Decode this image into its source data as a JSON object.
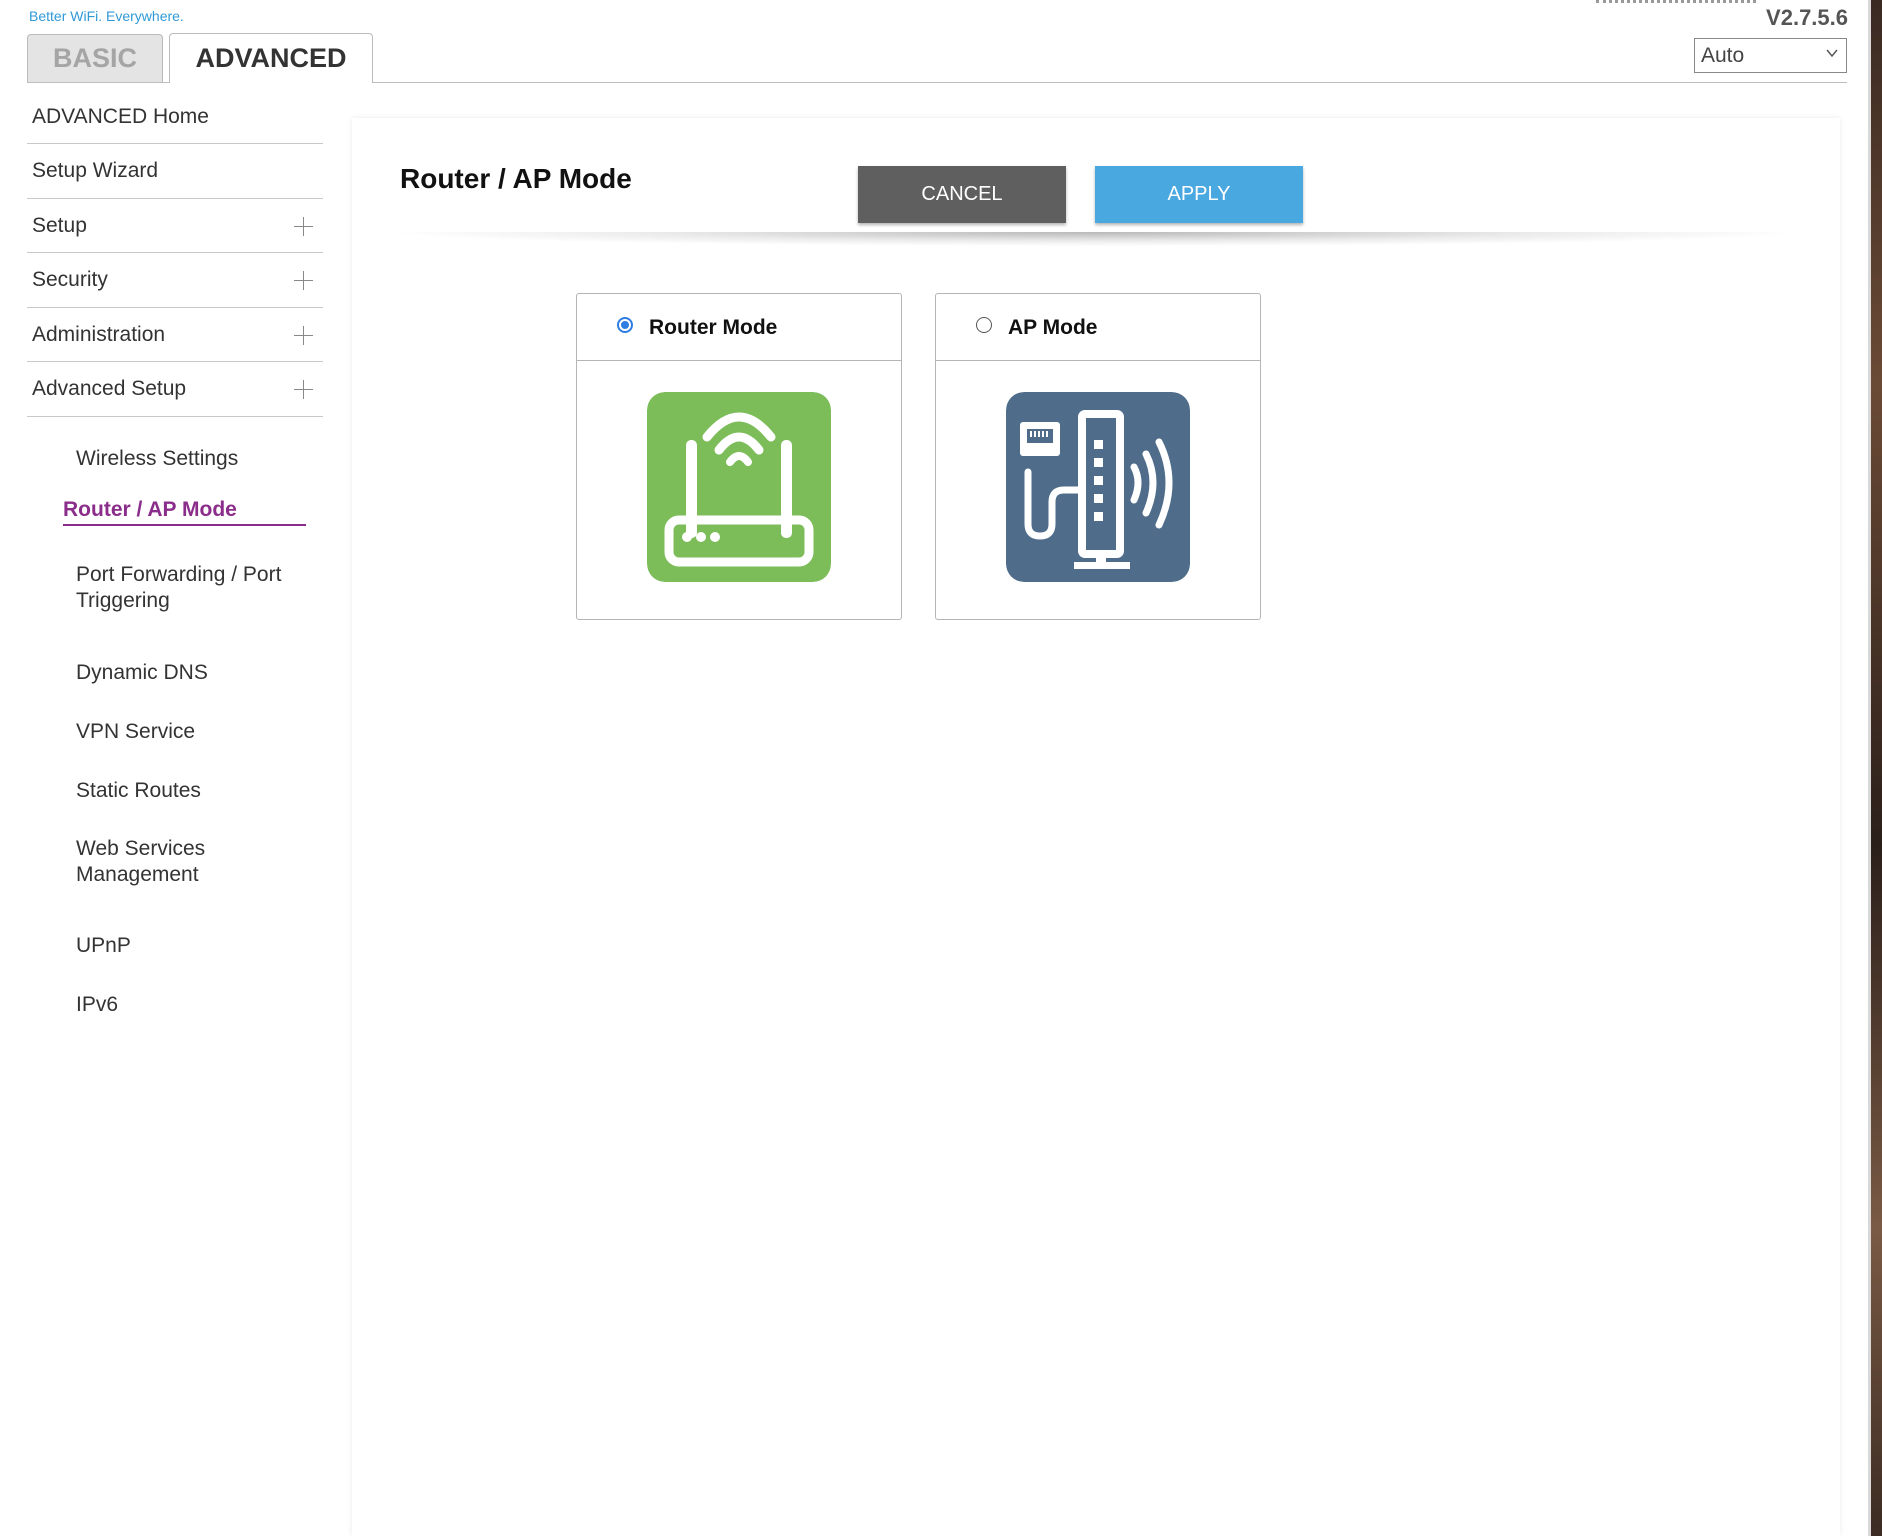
{
  "header": {
    "tagline": "Better WiFi. Everywhere.",
    "version": "V2.7.5.6",
    "language": "Auto"
  },
  "tabs": {
    "basic": "BASIC",
    "advanced": "ADVANCED"
  },
  "sidebar": {
    "main_items": [
      {
        "label": "ADVANCED Home"
      },
      {
        "label": "Setup Wizard"
      },
      {
        "label": "Setup"
      },
      {
        "label": "Security"
      },
      {
        "label": "Administration"
      },
      {
        "label": "Advanced Setup"
      }
    ],
    "sub_items": [
      {
        "label": "Wireless Settings"
      },
      {
        "label": "Router / AP Mode"
      },
      {
        "label": "Port Forwarding / Port Triggering"
      },
      {
        "label": "Dynamic DNS"
      },
      {
        "label": "VPN Service"
      },
      {
        "label": "Static Routes"
      },
      {
        "label": "Web Services Management"
      },
      {
        "label": "UPnP"
      },
      {
        "label": "IPv6"
      }
    ]
  },
  "main": {
    "title": "Router / AP Mode",
    "cancel_label": "CANCEL",
    "apply_label": "APPLY",
    "modes": [
      {
        "label": "Router Mode",
        "selected": true,
        "icon": "router-icon",
        "color": "#7cbd5a"
      },
      {
        "label": "AP Mode",
        "selected": false,
        "icon": "access-point-icon",
        "color": "#4f6d8a"
      }
    ]
  }
}
